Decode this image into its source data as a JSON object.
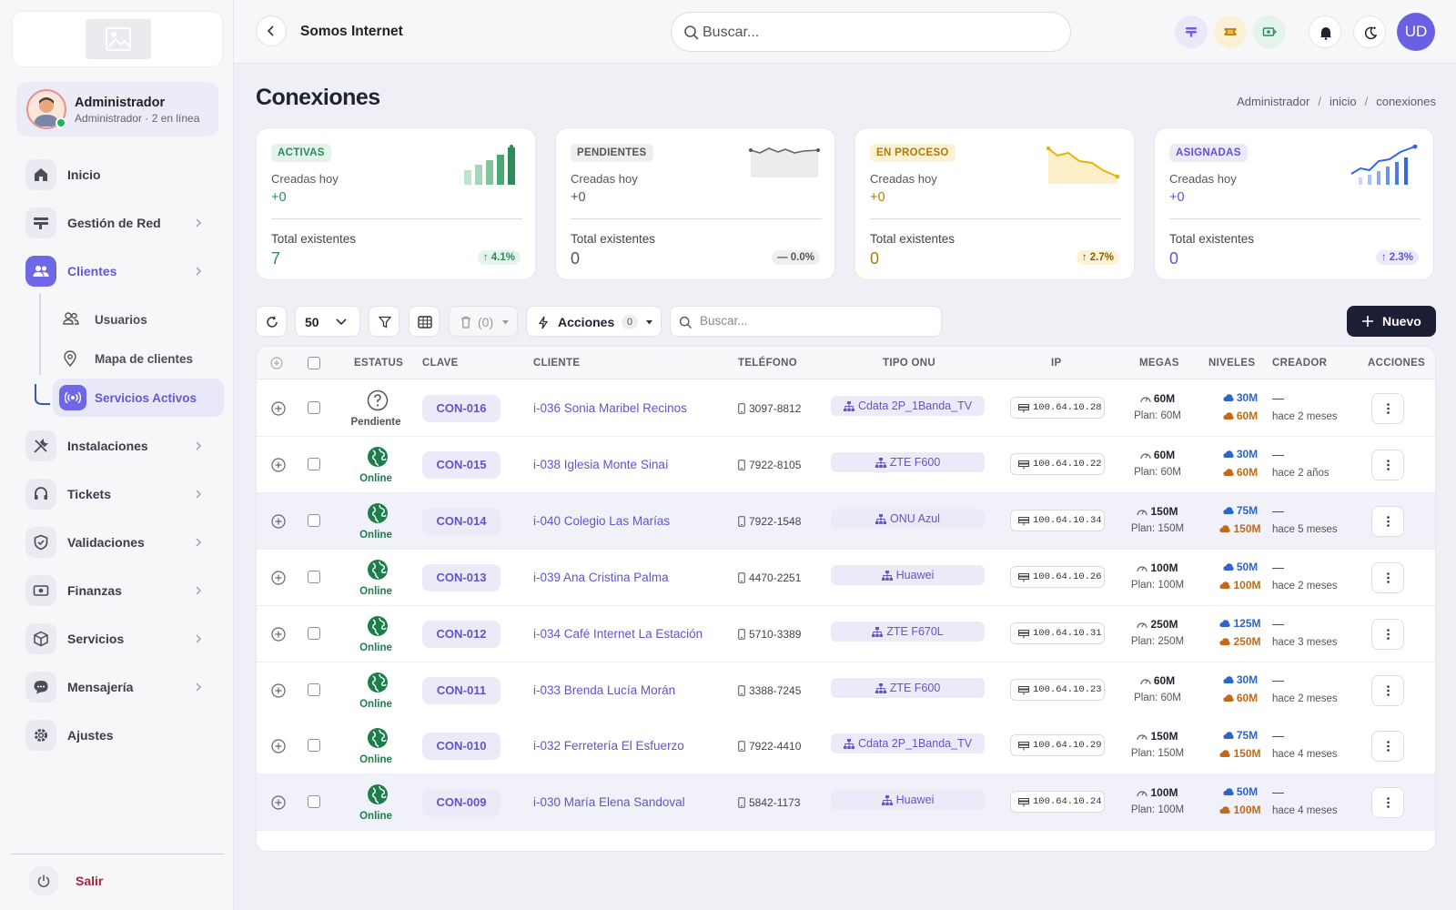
{
  "user": {
    "name": "Administrador",
    "subtitle": "Administrador · 2 en línea"
  },
  "nav": [
    {
      "label": "Inicio",
      "icon": "home-icon"
    },
    {
      "label": "Gestión de Red",
      "icon": "network-icon"
    },
    {
      "label": "Clientes",
      "icon": "users-icon"
    },
    {
      "label": "Instalaciones",
      "icon": "tools-icon"
    },
    {
      "label": "Tickets",
      "icon": "headset-icon"
    },
    {
      "label": "Validaciones",
      "icon": "shield-icon"
    },
    {
      "label": "Finanzas",
      "icon": "money-icon"
    },
    {
      "label": "Servicios",
      "icon": "box-icon"
    },
    {
      "label": "Mensajería",
      "icon": "chat-icon"
    },
    {
      "label": "Ajustes",
      "icon": "gear-icon"
    }
  ],
  "subnav": [
    {
      "label": "Usuarios"
    },
    {
      "label": "Mapa de clientes"
    },
    {
      "label": "Servicios Activos"
    }
  ],
  "logout": {
    "label": "Salir"
  },
  "header": {
    "company": "Somos Internet",
    "search_placeholder": "Buscar...",
    "avatar_initials": "UD"
  },
  "page": {
    "title": "Conexiones",
    "breadcrumb": [
      "Administrador",
      "inicio",
      "conexiones"
    ]
  },
  "cards": [
    {
      "badge": "ACTIVAS",
      "sub": "Creadas hoy",
      "today": "+0",
      "total_label": "Total existentes",
      "total": "7",
      "pct": "↑ 4.1%",
      "accent": "#2e8b57",
      "bg": "#e3f4ea"
    },
    {
      "badge": "PENDIENTES",
      "sub": "Creadas hoy",
      "today": "+0",
      "total_label": "Total existentes",
      "total": "0",
      "pct": "— 0.0%",
      "accent": "#555555",
      "bg": "#efeff1"
    },
    {
      "badge": "EN PROCESO",
      "sub": "Creadas hoy",
      "today": "+0",
      "total_label": "Total existentes",
      "total": "0",
      "pct": "↑ 2.7%",
      "accent": "#b07b06",
      "bg": "#fdf1d6"
    },
    {
      "badge": "ASIGNADAS",
      "sub": "Creadas hoy",
      "today": "+0",
      "total_label": "Total existentes",
      "total": "0",
      "pct": "↑ 2.3%",
      "accent": "#5b55d6",
      "bg": "#eceaf8"
    }
  ],
  "toolbar": {
    "page_size": "50",
    "trash_count": "(0)",
    "actions_label": "Acciones",
    "actions_count": "0",
    "search_placeholder": "Buscar...",
    "new_label": "Nuevo"
  },
  "table": {
    "headers": [
      "ESTATUS",
      "CLAVE",
      "CLIENTE",
      "TELÉFONO",
      "TIPO ONU",
      "IP",
      "MEGAS",
      "NIVELES",
      "CREADOR",
      "ACCIONES"
    ],
    "rows": [
      {
        "status": "Pendiente",
        "clave": "CON-016",
        "cliente": "i-036 Sonia Maribel Recinos",
        "tel": "3097-8812",
        "onu": "Cdata 2P_1Banda_TV",
        "ip": "100.64.10.28",
        "megas": "60M",
        "plan": "Plan: 60M",
        "down": "30M",
        "up": "60M",
        "creador": "—",
        "fecha": "hace 2 meses"
      },
      {
        "status": "Online",
        "clave": "CON-015",
        "cliente": "i-038 Iglesia Monte Sinaí",
        "tel": "7922-8105",
        "onu": "ZTE F600",
        "ip": "100.64.10.22",
        "megas": "60M",
        "plan": "Plan: 60M",
        "down": "30M",
        "up": "60M",
        "creador": "—",
        "fecha": "hace 2 años"
      },
      {
        "status": "Online",
        "clave": "CON-014",
        "cliente": "i-040 Colegio Las Marías",
        "tel": "7922-1548",
        "onu": "ONU Azul",
        "ip": "100.64.10.34",
        "megas": "150M",
        "plan": "Plan: 150M",
        "down": "75M",
        "up": "150M",
        "creador": "—",
        "fecha": "hace 5 meses"
      },
      {
        "status": "Online",
        "clave": "CON-013",
        "cliente": "i-039 Ana Cristina Palma",
        "tel": "4470-2251",
        "onu": "Huawei",
        "ip": "100.64.10.26",
        "megas": "100M",
        "plan": "Plan: 100M",
        "down": "50M",
        "up": "100M",
        "creador": "—",
        "fecha": "hace 2 meses"
      },
      {
        "status": "Online",
        "clave": "CON-012",
        "cliente": "i-034 Café Internet La Estación",
        "tel": "5710-3389",
        "onu": "ZTE F670L",
        "ip": "100.64.10.31",
        "megas": "250M",
        "plan": "Plan: 250M",
        "down": "125M",
        "up": "250M",
        "creador": "—",
        "fecha": "hace 3 meses"
      },
      {
        "status": "Online",
        "clave": "CON-011",
        "cliente": "i-033 Brenda Lucía Morán",
        "tel": "3388-7245",
        "onu": "ZTE F600",
        "ip": "100.64.10.23",
        "megas": "60M",
        "plan": "Plan: 60M",
        "down": "30M",
        "up": "60M",
        "creador": "—",
        "fecha": "hace 2 meses"
      },
      {
        "status": "Online",
        "clave": "CON-010",
        "cliente": "i-032 Ferretería El Esfuerzo",
        "tel": "7922-4410",
        "onu": "Cdata 2P_1Banda_TV",
        "ip": "100.64.10.29",
        "megas": "150M",
        "plan": "Plan: 150M",
        "down": "75M",
        "up": "150M",
        "creador": "—",
        "fecha": "hace 4 meses"
      },
      {
        "status": "Online",
        "clave": "CON-009",
        "cliente": "i-030 María Elena Sandoval",
        "tel": "5842-1173",
        "onu": "Huawei",
        "ip": "100.64.10.24",
        "megas": "100M",
        "plan": "Plan: 100M",
        "down": "50M",
        "up": "100M",
        "creador": "—",
        "fecha": "hace 4 meses"
      }
    ]
  }
}
